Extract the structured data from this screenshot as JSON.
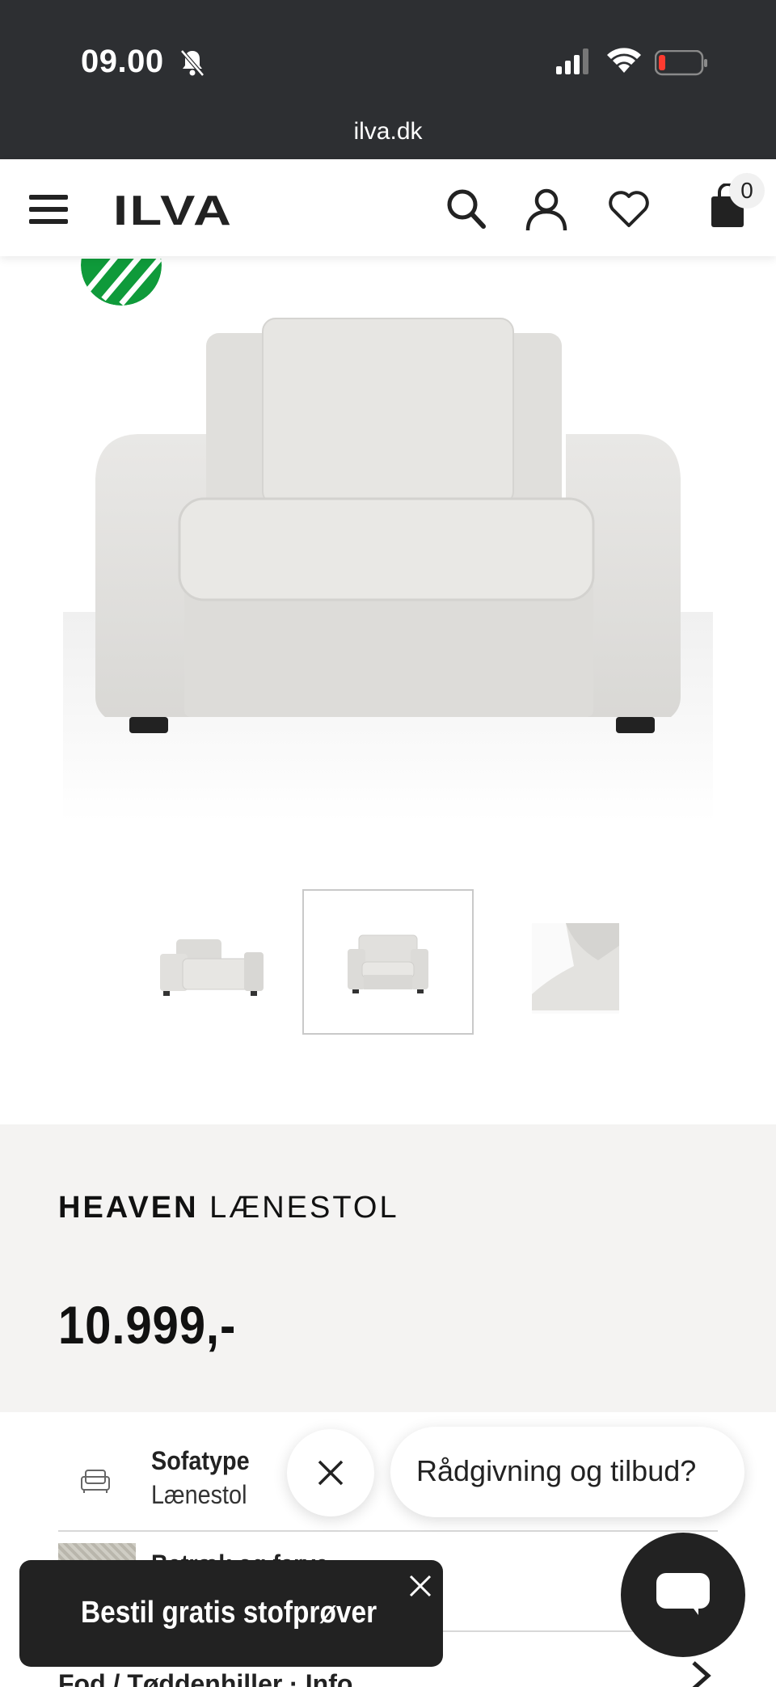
{
  "status_bar": {
    "time": "09.00",
    "url": "ilva.dk",
    "battery_color": "#ff3b30"
  },
  "header": {
    "logo": "ILVA",
    "cart_count": "0"
  },
  "gallery": {
    "thumbnail_count": 3,
    "active_index": 1
  },
  "product": {
    "brand": "HEAVEN",
    "type": "LÆNESTOL",
    "price": "10.999,-"
  },
  "options": {
    "sofatype_label": "Sofatype",
    "sofatype_value": "Lænestol",
    "upholstery_label": "Betræk og farve",
    "feet_label": "Fod / Tøddenhiller · Info"
  },
  "chat": {
    "bubble_text": "Rådgivning og tilbud?"
  },
  "toast": {
    "text": "Bestil gratis stofprøver"
  },
  "colors": {
    "chrome": "#2d2f32",
    "info_bg": "#f4f3f2",
    "dark": "#222222",
    "swan_green": "#0f9a3a"
  }
}
